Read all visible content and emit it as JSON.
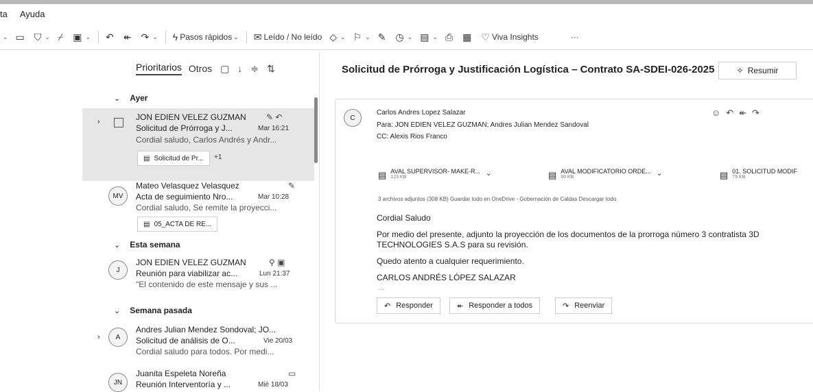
{
  "menubar": {
    "items": [
      "ta",
      "Ayuda"
    ]
  },
  "ribbon": {
    "quick_steps": "Pasos rápidos",
    "read_unread": "Leído / No leído",
    "viva": "Viva Insights",
    "more": "···"
  },
  "list": {
    "filters": {
      "focused": "Prioritarios",
      "other": "Otros"
    },
    "groups": {
      "yesterday": "Ayer",
      "this_week": "Esta semana",
      "last_week": "Semana pasada"
    },
    "items": [
      {
        "sender": "JON EDIEN VELEZ GUZMAN",
        "subject": "Solicitud de Prórroga y J...",
        "date": "Mar 16:21",
        "preview": "Cordial saludo, Carlos Andrés y Andr...",
        "attachment": "Solicitud de Pr...",
        "extra": "+1"
      },
      {
        "initials": "MV",
        "sender": "Mateo Velasquez Velasquez",
        "subject": "Acta de seguimiento Nro...",
        "date": "Mar 10:28",
        "preview": "Cordial saludo, Se remite la proyecci...",
        "attachment": "05_ACTA DE RE..."
      },
      {
        "initials": "J",
        "sender": "JON EDIEN VELEZ GUZMAN",
        "subject": "Reunión para viabilizar ac...",
        "date": "Lun 21:37",
        "preview": "\"El contenido de este mensaje y sus ..."
      },
      {
        "initials": "A",
        "sender": "Andres Julian Mendez Sondoval; JO...",
        "subject": "Solicitud de análisis de O...",
        "date": "Vie 20/03",
        "preview": "Cordial saludo para todos. Por medi..."
      },
      {
        "initials": "JN",
        "sender": "Juanita Espeleta Noreña",
        "subject": "Reunión Interventoría y ...",
        "date": "Mié 18/03"
      }
    ]
  },
  "reading": {
    "subject": "Solicitud de Prórroga y Justificación Logística – Contrato SA-SDEI-026-2025",
    "summarize": "Resumir",
    "from_initial": "C",
    "from": "Carlos Andres Lopez Salazar",
    "to_label": "Para:",
    "to": "JON EDIEN VELEZ GUZMAN;  Andres Julian Mendez Sandoval",
    "cc_label": "CC:",
    "cc": "Alexis Rios Franco",
    "attachments": [
      {
        "name": "AVAL SUPERVISOR- MAKE-R...",
        "size": "123 KB"
      },
      {
        "name": "AVAL MODIFICATORIO ORDE...",
        "size": "90 KB"
      },
      {
        "name": "01. SOLICITUD MODIF",
        "size": "79 KB"
      }
    ],
    "att_meta": "3 archivos adjuntos (308 KB)   Guardar todo en OneDrive - Gobernación de Caldas   Descargar todo",
    "greeting": "Cordial Saludo",
    "body1": "Por medio del presente, adjunto la proyección de los documentos de la prorroga número 3 contratista 3D",
    "body2": "TECHNOLOGIES S.A.S  para su revisión.",
    "body3": "Quedo atento a cualquier requerimiento.",
    "signature": "CARLOS ANDRÉS LÓPEZ SALAZAR",
    "ellipsis": "···",
    "reply": "Responder",
    "reply_all": "Responder a todos",
    "forward": "Reenviar"
  }
}
